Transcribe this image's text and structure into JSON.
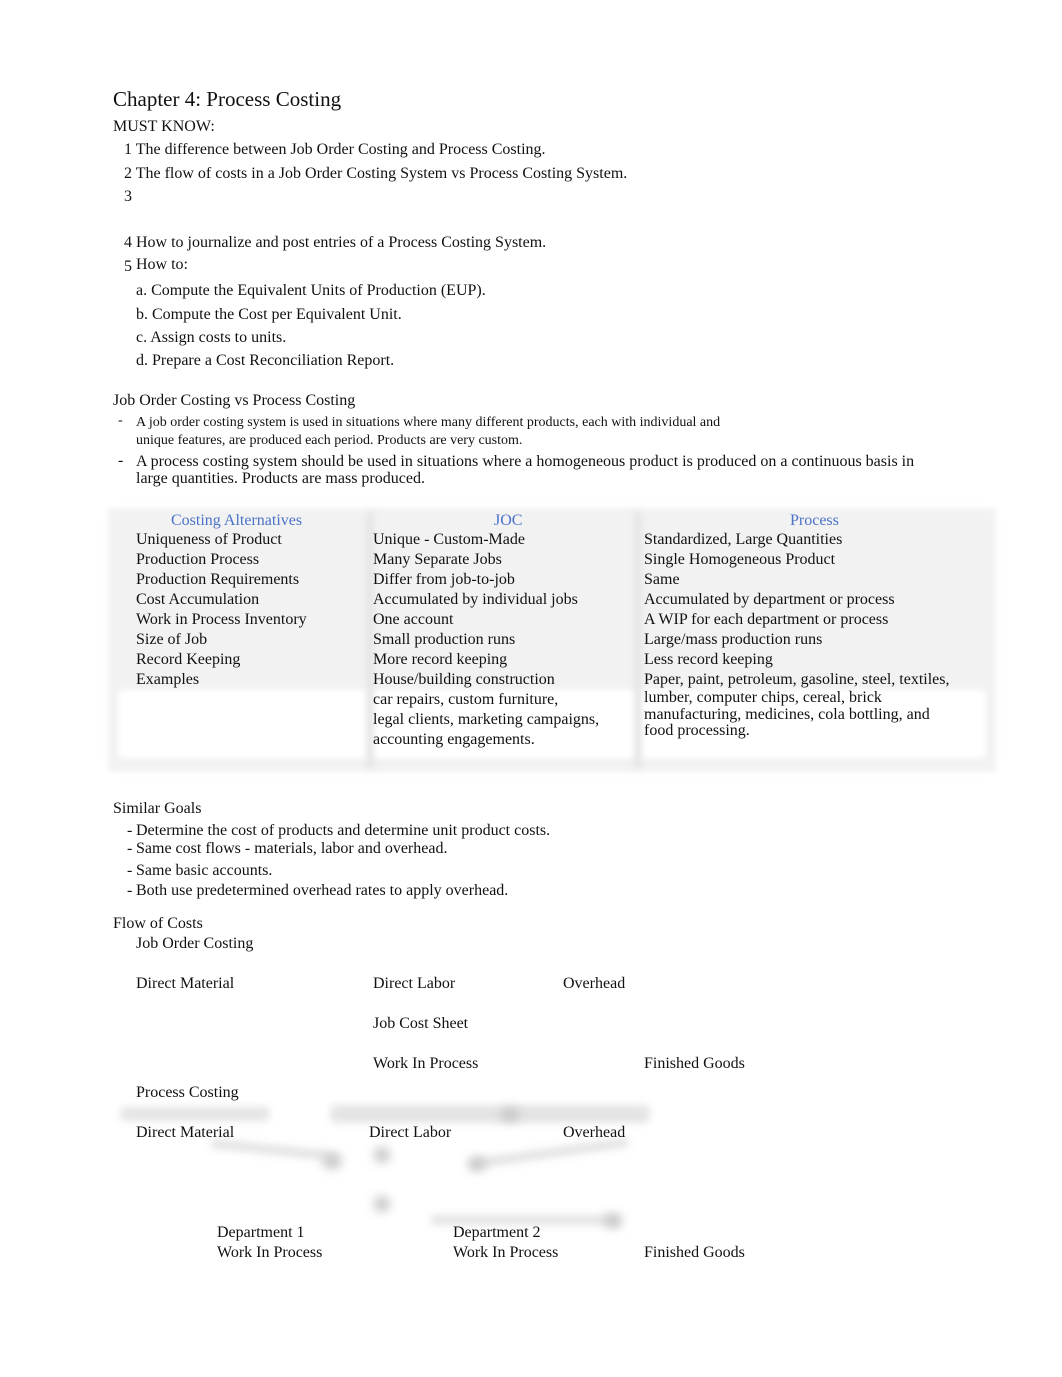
{
  "title": "Chapter 4: Process Costing",
  "must_know": {
    "heading": "MUST KNOW:",
    "items": [
      {
        "num": "1",
        "text": "The difference between Job Order Costing and Process Costing."
      },
      {
        "num": "2",
        "text": "The flow of costs in a Job Order Costing System vs Process Costing System."
      },
      {
        "num": "3",
        "text": ""
      },
      {
        "num": "4",
        "text": "How to journalize and post entries of a Process Costing System."
      },
      {
        "num": "5",
        "text": "How to:"
      }
    ],
    "sub_items": [
      "a. Compute the Equivalent Units of Production (EUP).",
      "b. Compute the Cost per Equivalent Unit.",
      "c. Assign costs to units.",
      "d. Prepare a Cost Reconciliation Report."
    ]
  },
  "comparison": {
    "heading": "Job Order Costing vs Process Costing",
    "bullet_marker": "-",
    "bullets": [
      [
        "A job order costing system is used in situations where many different products, each with individual and",
        "unique features, are produced each period. Products are very custom."
      ],
      [
        "A process costing system should be used in situations where a homogeneous product is produced on a continuous basis in",
        "large quantities. Products are mass produced."
      ]
    ]
  },
  "table": {
    "headers": [
      "Costing Alternatives",
      "JOC",
      "Process"
    ],
    "header_color": "#4a72c8",
    "rows": [
      [
        "Uniqueness of Product",
        "Unique - Custom-Made",
        "Standardized, Large Quantities"
      ],
      [
        "Production Process",
        "Many Separate Jobs",
        "Single Homogeneous Product"
      ],
      [
        "Production Requirements",
        "Differ from job-to-job",
        "Same"
      ],
      [
        "Cost Accumulation",
        "Accumulated by individual jobs",
        "Accumulated by department or process"
      ],
      [
        "Work in Process Inventory",
        "One account",
        "A WIP for each department or process"
      ],
      [
        "Size of Job",
        "Small production runs",
        "Large/mass production runs"
      ],
      [
        "Record Keeping",
        "More record keeping",
        "Less record keeping"
      ]
    ],
    "examples": {
      "label": "Examples",
      "joc": [
        "House/building construction",
        "car repairs, custom furniture,",
        "legal clients, marketing campaigns,",
        "accounting engagements."
      ],
      "process": [
        "Paper, paint, petroleum, gasoline, steel, textiles,",
        "lumber, computer chips, cereal, brick",
        "manufacturing, medicines, cola bottling, and",
        "food processing."
      ]
    }
  },
  "similar_goals": {
    "heading": "Similar Goals",
    "bullet_marker": "-",
    "items": [
      "Determine the cost of products and determine unit product costs.",
      "Same cost flows - materials, labor and overhead.",
      "Same basic accounts.",
      "Both use predetermined overhead rates to apply overhead."
    ]
  },
  "flow": {
    "heading": "Flow of Costs",
    "job_order": {
      "label": "Job Order Costing",
      "direct_material": "Direct Material",
      "direct_labor": "Direct Labor",
      "overhead": "Overhead",
      "job_cost_sheet": "Job Cost Sheet",
      "wip": "Work In Process",
      "finished_goods": "Finished Goods"
    },
    "process": {
      "label": "Process Costing",
      "direct_material": "Direct Material",
      "direct_labor": "Direct Labor",
      "overhead": "Overhead",
      "dept1": [
        "Department 1",
        "Work In Process"
      ],
      "dept2": [
        "Department 2",
        "Work In Process"
      ],
      "finished_goods": "Finished Goods"
    }
  }
}
